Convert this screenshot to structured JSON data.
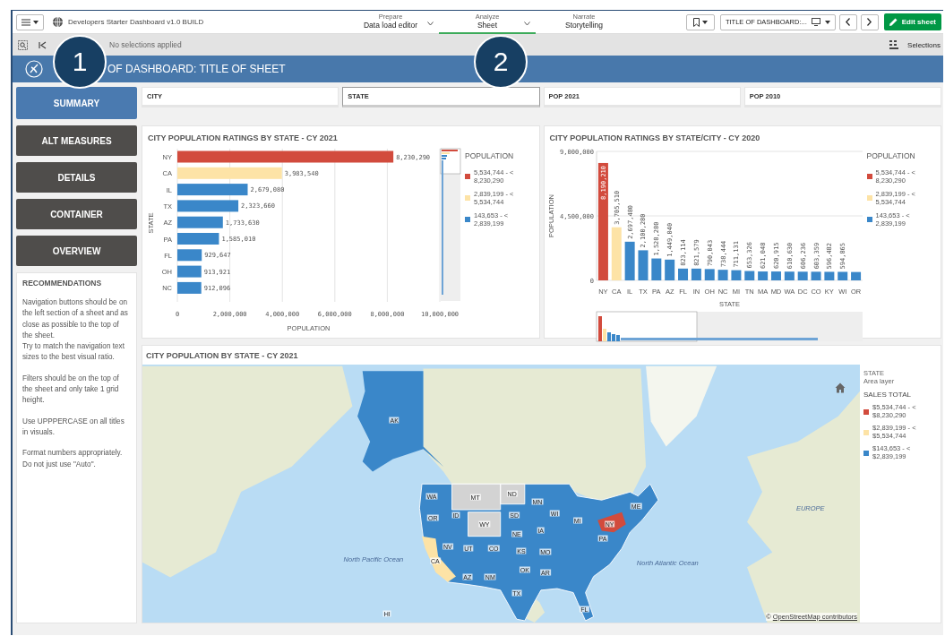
{
  "app_bar": {
    "app_title": "Developers Starter Dashboard v1.0 BUILD",
    "nav_tabs": [
      {
        "caption": "Prepare",
        "label": "Data load editor",
        "selected": false,
        "has_menu": true
      },
      {
        "caption": "Analyze",
        "label": "Sheet",
        "selected": true,
        "has_menu": true
      },
      {
        "caption": "Narrate",
        "label": "Storytelling",
        "selected": false,
        "has_menu": false
      }
    ],
    "sheet_selector": "TITLE OF DASHBOARD:...",
    "edit_button": "Edit sheet"
  },
  "selection_bar": {
    "status": "No selections applied",
    "selections_button": "Selections"
  },
  "sheet_header": {
    "title": "OF DASHBOARD: TITLE OF SHEET"
  },
  "callouts": [
    "1",
    "2"
  ],
  "nav_buttons": [
    {
      "label": "SUMMARY",
      "selected": true
    },
    {
      "label": "ALT MEASURES",
      "selected": false
    },
    {
      "label": "DETAILS",
      "selected": false
    },
    {
      "label": "CONTAINER",
      "selected": false
    },
    {
      "label": "OVERVIEW",
      "selected": false
    }
  ],
  "recommendations": {
    "title": "RECOMMENDATIONS",
    "blocks": [
      [
        "Navigation buttons should be on the left section of a sheet and as close as possible to the top of the sheet.",
        "Try to match the navigation text sizes to the best visual ratio."
      ],
      [
        "Filters should be on the top of the sheet and only take 1 grid height."
      ],
      [
        "Use UPPPERCASE on all titles in visuals."
      ],
      [
        "Format numbers appropriately.",
        "Do not just use \"Auto\"."
      ]
    ]
  },
  "filters": [
    {
      "label": "CITY",
      "selected": false
    },
    {
      "label": "STATE",
      "selected": true
    },
    {
      "label": "POP 2021",
      "selected": false
    },
    {
      "label": "POP 2010",
      "selected": false
    }
  ],
  "chart_2021": {
    "legend_title": "POPULATION",
    "chart_data": {
      "type": "bar",
      "orientation": "horizontal",
      "stacked": true,
      "grid": true,
      "title": "CITY POPULATION RATINGS BY STATE - CY 2021",
      "xlabel": "POPULATION",
      "ylabel": "STATE",
      "categories": [
        "NY",
        "CA",
        "IL",
        "TX",
        "AZ",
        "PA",
        "FL",
        "OH",
        "NC"
      ],
      "series": [
        {
          "name": "5,534,744 - < 8,230,290",
          "color": "#d24b3d",
          "values": [
            8230290,
            null,
            null,
            null,
            null,
            null,
            null,
            null,
            null
          ]
        },
        {
          "name": "2,839,199 - < 5,534,744",
          "color": "#fde3a6",
          "values": [
            null,
            3983540,
            null,
            null,
            null,
            null,
            null,
            null,
            null
          ]
        },
        {
          "name": "143,653 - < 2,839,199",
          "color": "#3a87c9",
          "values": [
            null,
            null,
            2679080,
            2323660,
            1733630,
            1585010,
            929647,
            913921,
            912096
          ]
        }
      ],
      "xlim": [
        0,
        10000000
      ],
      "xticks": [
        {
          "value": 0,
          "label": "0"
        },
        {
          "value": 2000000,
          "label": "2,000,000"
        },
        {
          "value": 4000000,
          "label": "4,000,000"
        },
        {
          "value": 6000000,
          "label": "6,000,000"
        },
        {
          "value": 8000000,
          "label": "8,000,000"
        },
        {
          "value": 10000000,
          "label": "10,000,000"
        }
      ],
      "value_labels": [
        "8,230,290",
        "3,983,540",
        "2,679,080",
        "2,323,660",
        "1,733,630",
        "1,585,010",
        "929,647",
        "913,921",
        "912,096"
      ]
    }
  },
  "chart_2020": {
    "legend_title": "POPULATION",
    "chart_data": {
      "type": "bar",
      "orientation": "vertical",
      "stacked": true,
      "grid": true,
      "title": "CITY POPULATION RATINGS BY STATE/CITY - CY 2020",
      "xlabel": "STATE",
      "ylabel": "POPULATION",
      "categories": [
        "NY",
        "CA",
        "IL",
        "TX",
        "PA",
        "AZ",
        "FL",
        "IN",
        "OH",
        "NC",
        "MI",
        "TN",
        "MA",
        "MD",
        "WA",
        "DC",
        "CO",
        "KY",
        "WI",
        "OR"
      ],
      "series": [
        {
          "name": "5,534,744 - < 8,230,290",
          "color": "#d24b3d",
          "values": [
            8190210,
            null,
            null,
            null,
            null,
            null,
            null,
            null,
            null,
            null,
            null,
            null,
            null,
            null,
            null,
            null,
            null,
            null,
            null,
            null
          ]
        },
        {
          "name": "2,839,199 - < 5,534,744",
          "color": "#fde3a6",
          "values": [
            null,
            3705510,
            null,
            null,
            null,
            null,
            null,
            null,
            null,
            null,
            null,
            null,
            null,
            null,
            null,
            null,
            null,
            null,
            null,
            null
          ]
        },
        {
          "name": "143,653 - < 2,839,199",
          "color": "#3a87c9",
          "values": [
            null,
            null,
            2697480,
            2100280,
            1528280,
            1449040,
            823114,
            821579,
            790043,
            738444,
            711131,
            653326,
            621048,
            620915,
            610630,
            606236,
            603359,
            596482,
            594865,
            584000
          ]
        }
      ],
      "ylim": [
        0,
        9000000
      ],
      "yticks": [
        {
          "value": 0,
          "label": "0"
        },
        {
          "value": 4500000,
          "label": "4,500,000"
        },
        {
          "value": 9000000,
          "label": "9,000,000"
        }
      ],
      "value_labels": [
        "8,190,210",
        "3,705,510",
        "2,697,480",
        "2,100,280",
        "1,528,280",
        "1,449,040",
        "823,114",
        "821,579",
        "790,043",
        "738,444",
        "711,131",
        "653,326",
        "621,048",
        "620,915",
        "610,630",
        "606,236",
        "603,359",
        "596,482",
        "594,865",
        null
      ]
    }
  },
  "map": {
    "title": "CITY POPULATION BY STATE - CY 2021",
    "region_labels": [
      "WA",
      "OR",
      "ID",
      "MT",
      "ND",
      "MN",
      "WY",
      "SD",
      "NE",
      "IA",
      "WI",
      "MI",
      "NV",
      "UT",
      "CO",
      "KS",
      "MO",
      "CA",
      "AZ",
      "NM",
      "OK",
      "AR",
      "TX",
      "FL",
      "NY",
      "PA",
      "ME",
      "AK",
      "HI"
    ],
    "place_labels": [
      "North Pacific Ocean",
      "North Atlantic Ocean",
      "EUROPE"
    ],
    "legend": {
      "layer": "STATE",
      "layer_kind": "Area layer",
      "title": "SALES TOTAL",
      "items": [
        {
          "label": "$5,534,744 - < $8,230,290",
          "color": "#d24b3d"
        },
        {
          "label": "$2,839,199 - < $5,534,744",
          "color": "#fde3a6"
        },
        {
          "label": "$143,653 - < $2,839,199",
          "color": "#3a87c9"
        }
      ]
    },
    "attribution_prefix": "©",
    "attribution_link": "OpenStreetMap contributors"
  }
}
